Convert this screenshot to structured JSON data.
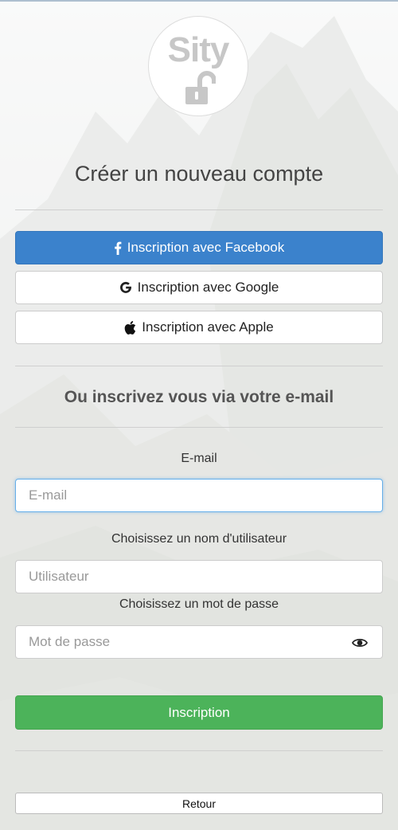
{
  "logo": {
    "text": "Sity",
    "icon": "open-padlock-icon"
  },
  "title": "Créer un nouveau compte",
  "social": {
    "facebook": {
      "label": "Inscription avec Facebook",
      "icon": "facebook-icon",
      "color": "#3b82cc"
    },
    "google": {
      "label": "Inscription avec Google",
      "icon": "google-icon"
    },
    "apple": {
      "label": "Inscription avec Apple",
      "icon": "apple-icon"
    }
  },
  "subtitle": "Ou inscrivez vous via votre e-mail",
  "form": {
    "email": {
      "label": "E-mail",
      "placeholder": "E-mail",
      "value": ""
    },
    "username": {
      "label": "Choisissez un nom d'utilisateur",
      "placeholder": "Utilisateur",
      "value": ""
    },
    "password": {
      "label": "Choisissez un mot de passe",
      "placeholder": "Mot de passe",
      "value": "",
      "toggle_icon": "eye-icon"
    },
    "submit_label": "Inscription",
    "submit_color": "#4cb35a"
  },
  "back_label": "Retour"
}
